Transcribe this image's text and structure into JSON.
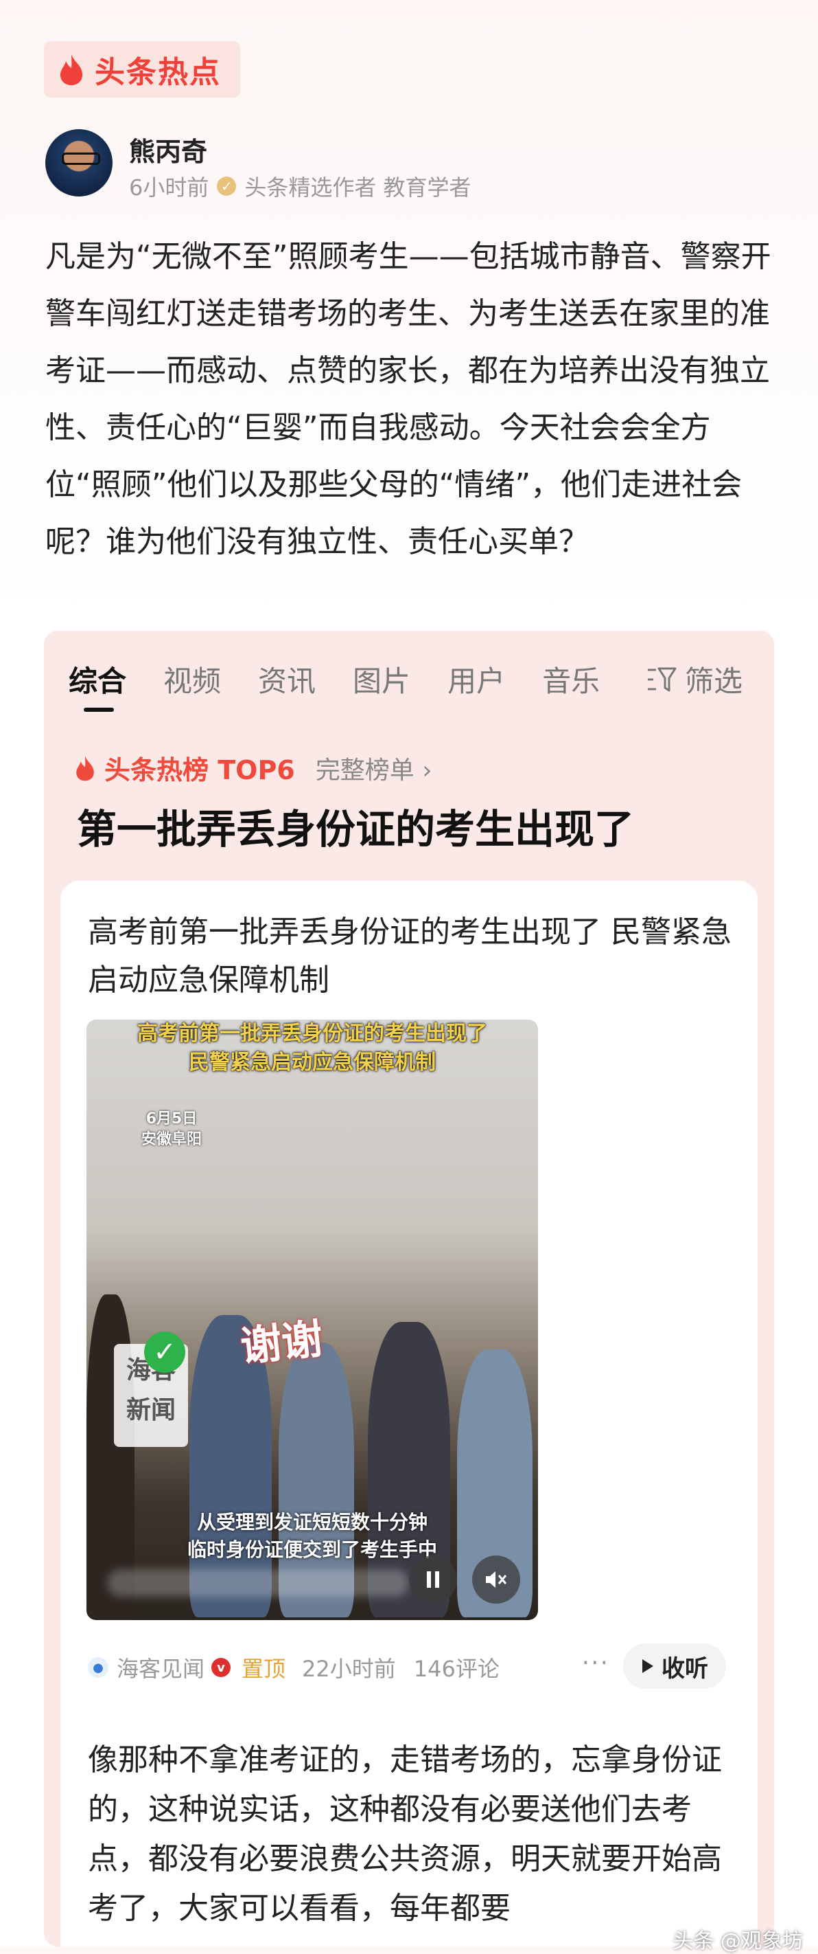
{
  "header": {
    "badge_label": "头条热点"
  },
  "author": {
    "name": "熊丙奇",
    "time": "6小时前",
    "tags": "头条精选作者 教育学者"
  },
  "post": {
    "text": "凡是为“无微不至”照顾考生——包括城市静音、警察开警车闯红灯送走错考场的考生、为考生送丢在家里的准考证——而感动、点赞的家长，都在为培养出没有独立性、责任心的“巨婴”而自我感动。今天社会会全方位“照顾”他们以及那些父母的“情绪”，他们走进社会呢？谁为他们没有独立性、责任心买单？"
  },
  "search": {
    "tabs": [
      "综合",
      "视频",
      "资讯",
      "图片",
      "用户",
      "音乐"
    ],
    "active_tab": "综合",
    "filter_label": "筛选",
    "hot_label": "头条热榜 TOP6",
    "hot_full": "完整榜单 ›",
    "hot_title": "第一批弄丢身份证的考生出现了"
  },
  "news": {
    "title": "高考前第一批弄丢身份证的考生出现了 民警紧急启动应急保障机制",
    "video": {
      "caption_line1": "高考前第一批弄丢身份证的考生出现了",
      "caption_line2": "民警紧急启动应急保障机制",
      "date": "6月5日",
      "place": "安徽阜阳",
      "overlay": "谢谢",
      "logo_top": "海客",
      "logo_bottom": "新闻",
      "sub_line1": "从受理到发证短短数十分钟",
      "sub_line2": "临时身份证便交到了考生手中"
    },
    "source": "海客见闻",
    "pinned": "置顶",
    "time": "22小时前",
    "comments": "146评论",
    "more": "···",
    "listen_label": "收听",
    "body": "像那种不拿准考证的，走错考场的，忘拿身份证的，这种说实话，这种都没有必要送他们去考点，都没有必要浪费公共资源，明天就要开始高考了，大家可以看看，每年都要"
  },
  "watermark": "头条 @观象坊",
  "colors": {
    "accent": "#f0403a",
    "pinned": "#e5a335"
  }
}
